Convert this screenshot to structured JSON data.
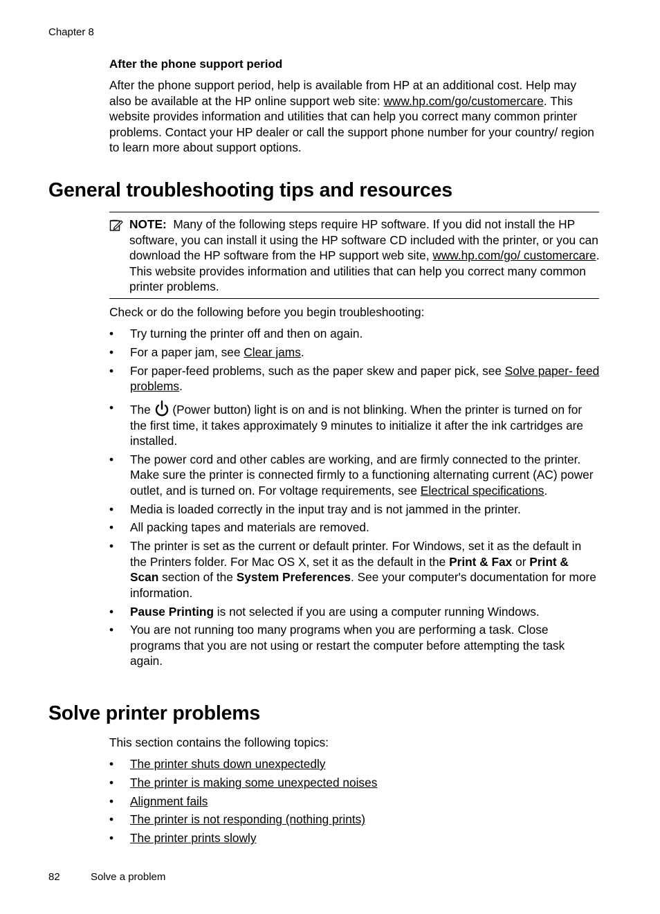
{
  "running_head": "Chapter 8",
  "after_support": {
    "heading": "After the phone support period",
    "text_before_link": "After the phone support period, help is available from HP at an additional cost. Help may also be available at the HP online support web site: ",
    "link": "www.hp.com/go/customercare",
    "text_after_link": ". This website provides information and utilities that can help you correct many common printer problems. Contact your HP dealer or call the support phone number for your country/ region to learn more about support options."
  },
  "general": {
    "title": "General troubleshooting tips and resources",
    "note": {
      "label": "NOTE:",
      "text_before_link": "  Many of the following steps require HP software. If you did not install the HP software, you can install it using the HP software CD included with the printer, or you can download the HP software from the HP support web site, ",
      "link": "www.hp.com/go/ customercare",
      "text_after_link": ". This website provides information and utilities that can help you correct many common printer problems."
    },
    "intro": "Check or do the following before you begin troubleshooting:",
    "bullets": {
      "b1": "Try turning the printer off and then on again.",
      "b2_pre": "For a paper jam, see ",
      "b2_link": "Clear jams",
      "b2_post": ".",
      "b3_pre": "For paper-feed problems, such as the paper skew and paper pick, see ",
      "b3_link": "Solve paper- feed problems",
      "b3_post": ".",
      "b4_pre": "The ",
      "b4_post": " (Power button) light is on and is not blinking. When the printer is turned on for the first time, it takes approximately 9 minutes to initialize it after the ink cartridges are installed.",
      "b5_pre": "The power cord and other cables are working, and are firmly connected to the printer. Make sure the printer is connected firmly to a functioning alternating current (AC) power outlet, and is turned on. For voltage requirements, see ",
      "b5_link": "Electrical specifications",
      "b5_post": ".",
      "b6": "Media is loaded correctly in the input tray and is not jammed in the printer.",
      "b7": "All packing tapes and materials are removed.",
      "b8_a": "The printer is set as the current or default printer. For Windows, set it as the default in the Printers folder. For Mac OS X, set it as the default in the ",
      "b8_b1": "Print & Fax",
      "b8_c": " or ",
      "b8_b2": "Print & Scan",
      "b8_d": " section of the ",
      "b8_b3": "System Preferences",
      "b8_e": ". See your computer's documentation for more information.",
      "b9_bold": "Pause Printing",
      "b9_rest": " is not selected if you are using a computer running Windows.",
      "b10": "You are not running too many programs when you are performing a task. Close programs that you are not using or restart the computer before attempting the task again."
    }
  },
  "solve": {
    "title": "Solve printer problems",
    "intro": "This section contains the following topics:",
    "topics": [
      "The printer shuts down unexpectedly",
      "The printer is making some unexpected noises",
      "Alignment fails",
      "The printer is not responding (nothing prints)",
      "The printer prints slowly"
    ]
  },
  "footer": {
    "page_number": "82",
    "section": "Solve a problem"
  }
}
